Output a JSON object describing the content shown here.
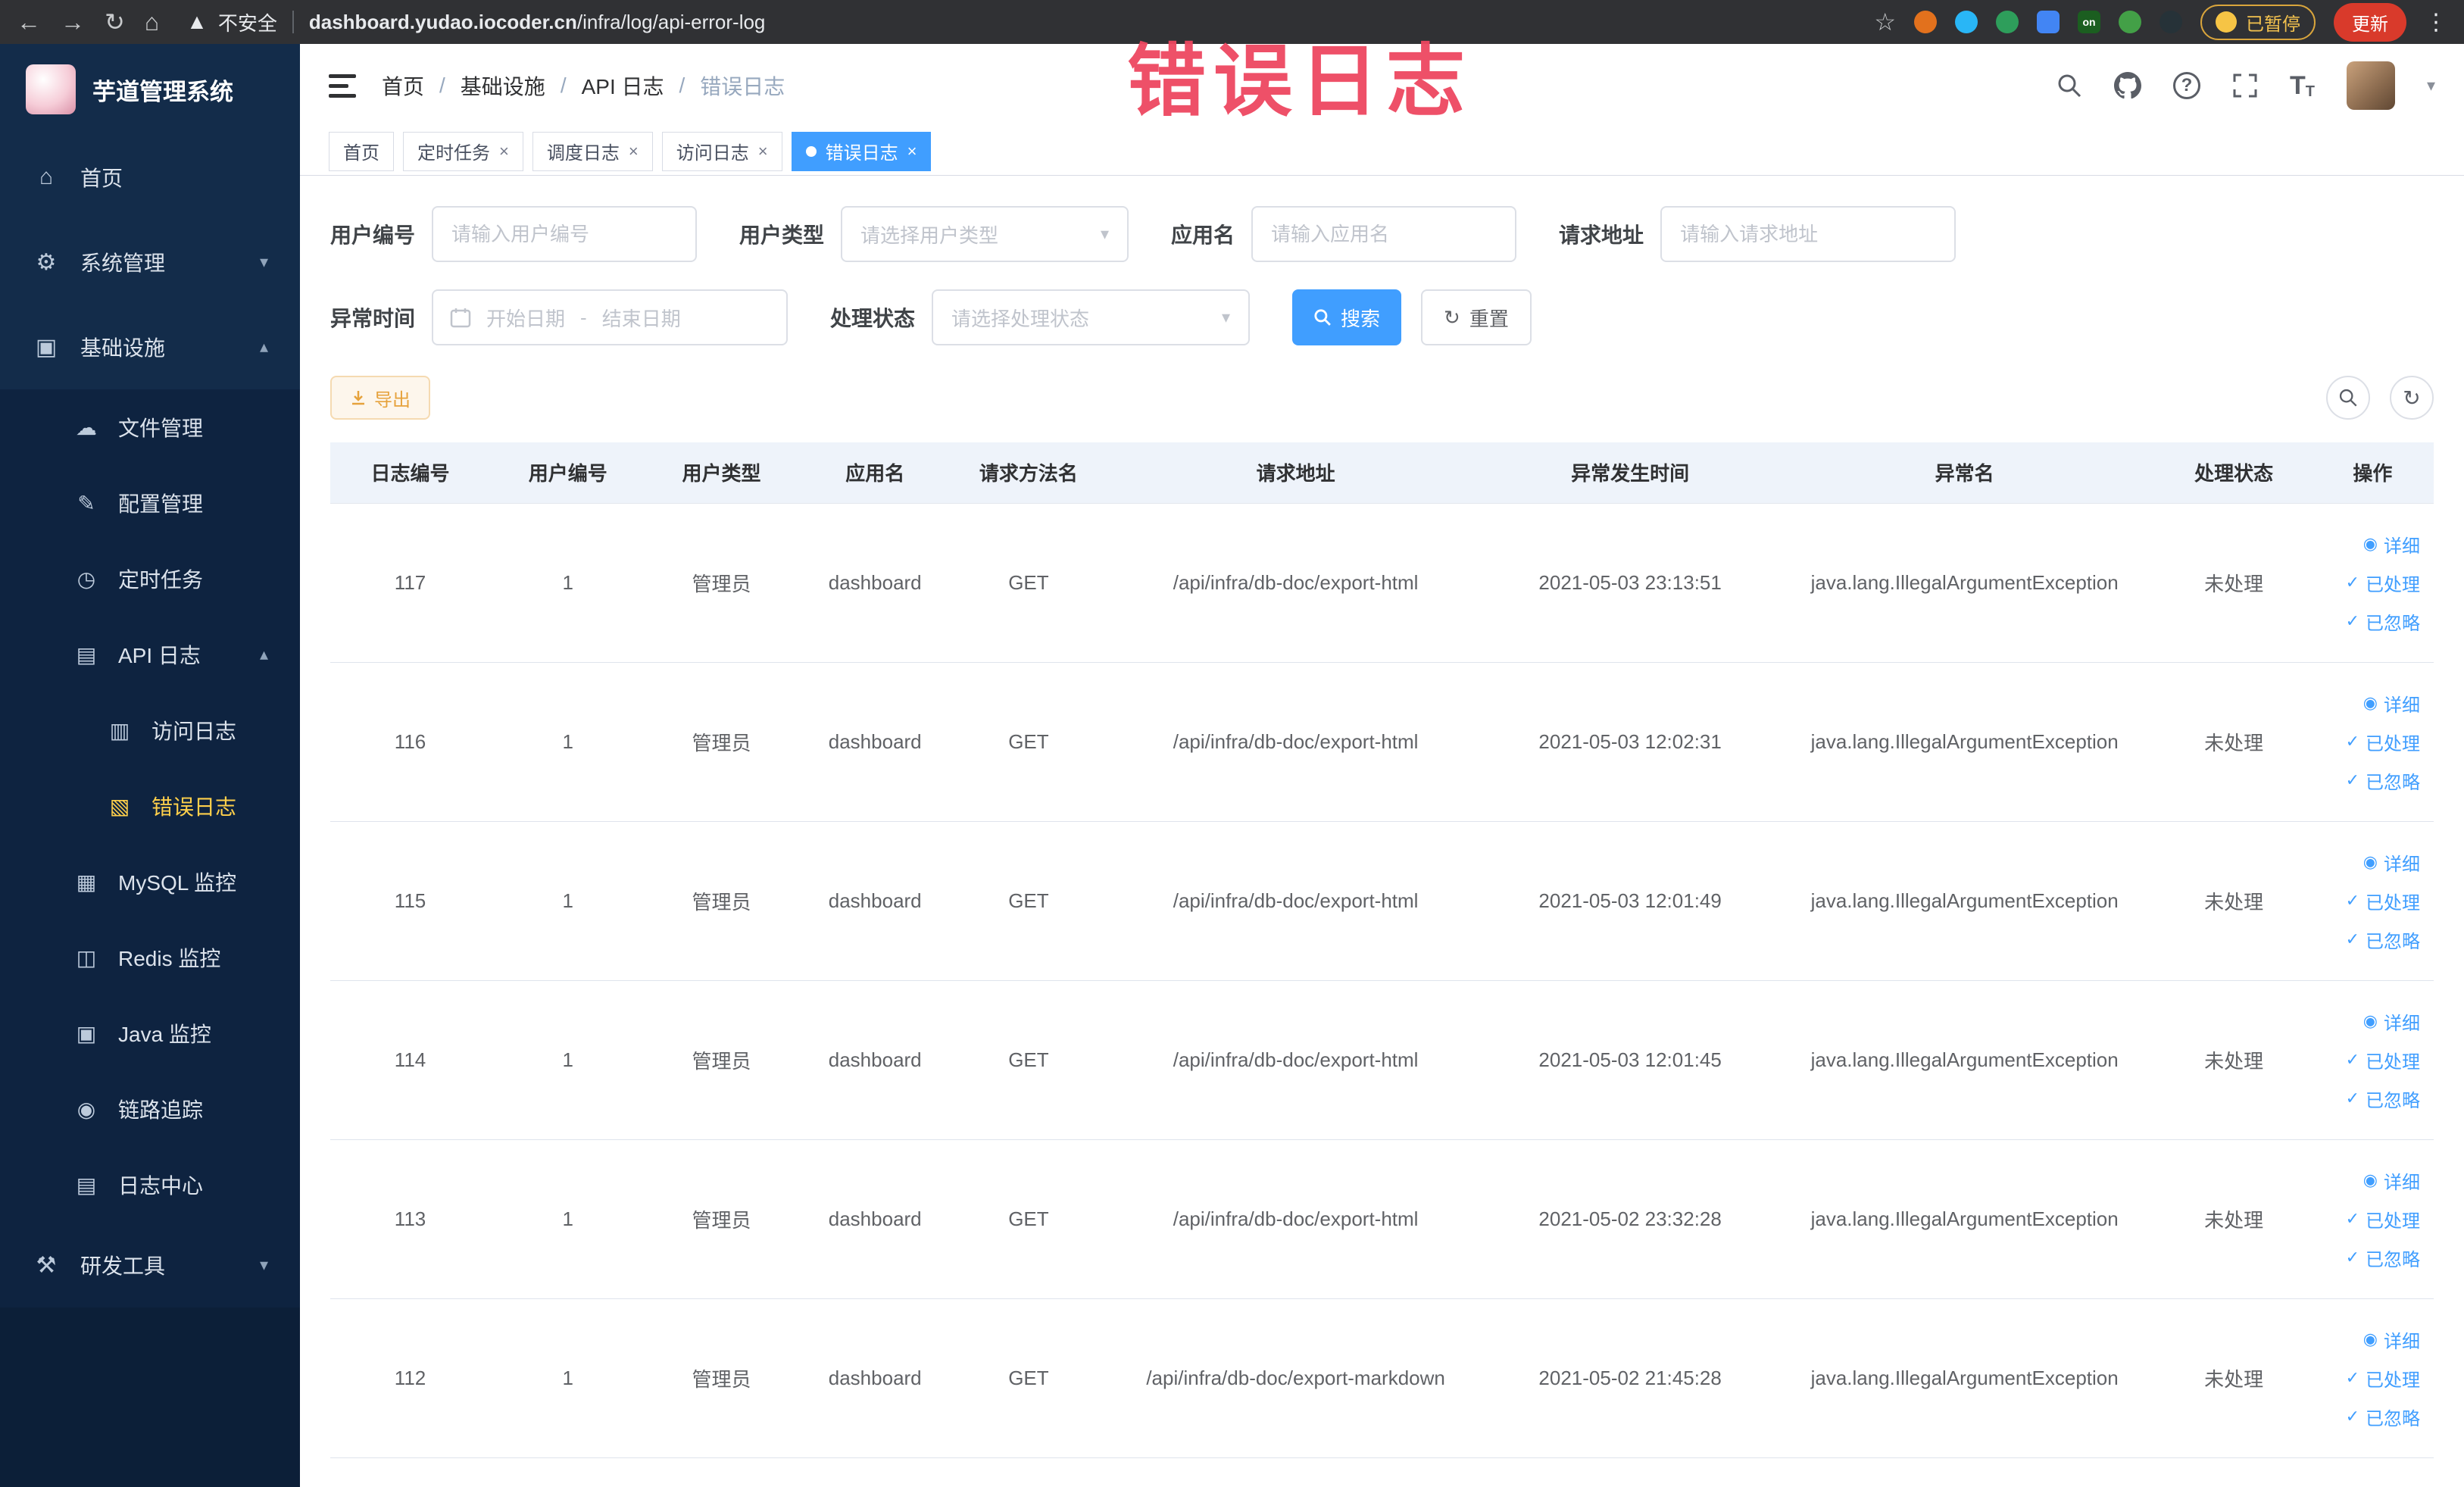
{
  "browser": {
    "security_warning": "不安全",
    "url_domain": "dashboard.yudao.iocoder.cn",
    "url_path": "/infra/log/api-error-log",
    "extension_on_label": "on",
    "paused_badge": "已暂停",
    "update_button": "更新"
  },
  "annotation": {
    "text": "错误日志"
  },
  "sidebar": {
    "title": "芋道管理系统",
    "home": "首页",
    "system": "系统管理",
    "infra": "基础设施",
    "file": "文件管理",
    "config": "配置管理",
    "job": "定时任务",
    "api_log": "API 日志",
    "access_log": "访问日志",
    "error_log": "错误日志",
    "mysql": "MySQL 监控",
    "redis": "Redis 监控",
    "java": "Java 监控",
    "trace": "链路追踪",
    "log_center": "日志中心",
    "dev_tools": "研发工具"
  },
  "breadcrumb": [
    "首页",
    "基础设施",
    "API 日志",
    "错误日志"
  ],
  "header_icons": {
    "help": "?",
    "font": "T",
    "font_small": "T"
  },
  "tabs": [
    "首页",
    "定时任务",
    "调度日志",
    "访问日志",
    "错误日志"
  ],
  "filters": {
    "user_id": {
      "label": "用户编号",
      "placeholder": "请输入用户编号"
    },
    "user_type": {
      "label": "用户类型",
      "placeholder": "请选择用户类型"
    },
    "app_name": {
      "label": "应用名",
      "placeholder": "请输入应用名"
    },
    "request_url": {
      "label": "请求地址",
      "placeholder": "请输入请求地址"
    },
    "exception_time": {
      "label": "异常时间",
      "start": "开始日期",
      "separator": "-",
      "end": "结束日期"
    },
    "process_status": {
      "label": "处理状态",
      "placeholder": "请选择处理状态"
    },
    "search": "搜索",
    "reset": "重置"
  },
  "toolbar": {
    "export": "导出"
  },
  "table": {
    "headers": [
      "日志编号",
      "用户编号",
      "用户类型",
      "应用名",
      "请求方法名",
      "请求地址",
      "异常发生时间",
      "异常名",
      "处理状态",
      "操作"
    ],
    "actions": {
      "detail": "详细",
      "done": "已处理",
      "ignore": "已忽略"
    },
    "rows": [
      {
        "id": "117",
        "user_id": "1",
        "user_type": "管理员",
        "app": "dashboard",
        "method": "GET",
        "url": "/api/infra/db-doc/export-html",
        "time": "2021-05-03 23:13:51",
        "exception": "java.lang.IllegalArgumentException",
        "status": "未处理"
      },
      {
        "id": "116",
        "user_id": "1",
        "user_type": "管理员",
        "app": "dashboard",
        "method": "GET",
        "url": "/api/infra/db-doc/export-html",
        "time": "2021-05-03 12:02:31",
        "exception": "java.lang.IllegalArgumentException",
        "status": "未处理"
      },
      {
        "id": "115",
        "user_id": "1",
        "user_type": "管理员",
        "app": "dashboard",
        "method": "GET",
        "url": "/api/infra/db-doc/export-html",
        "time": "2021-05-03 12:01:49",
        "exception": "java.lang.IllegalArgumentException",
        "status": "未处理"
      },
      {
        "id": "114",
        "user_id": "1",
        "user_type": "管理员",
        "app": "dashboard",
        "method": "GET",
        "url": "/api/infra/db-doc/export-html",
        "time": "2021-05-03 12:01:45",
        "exception": "java.lang.IllegalArgumentException",
        "status": "未处理"
      },
      {
        "id": "113",
        "user_id": "1",
        "user_type": "管理员",
        "app": "dashboard",
        "method": "GET",
        "url": "/api/infra/db-doc/export-html",
        "time": "2021-05-02 23:32:28",
        "exception": "java.lang.IllegalArgumentException",
        "status": "未处理"
      },
      {
        "id": "112",
        "user_id": "1",
        "user_type": "管理员",
        "app": "dashboard",
        "method": "GET",
        "url": "/api/infra/db-doc/export-markdown",
        "time": "2021-05-02 21:45:28",
        "exception": "java.lang.IllegalArgumentException",
        "status": "未处理"
      }
    ]
  }
}
